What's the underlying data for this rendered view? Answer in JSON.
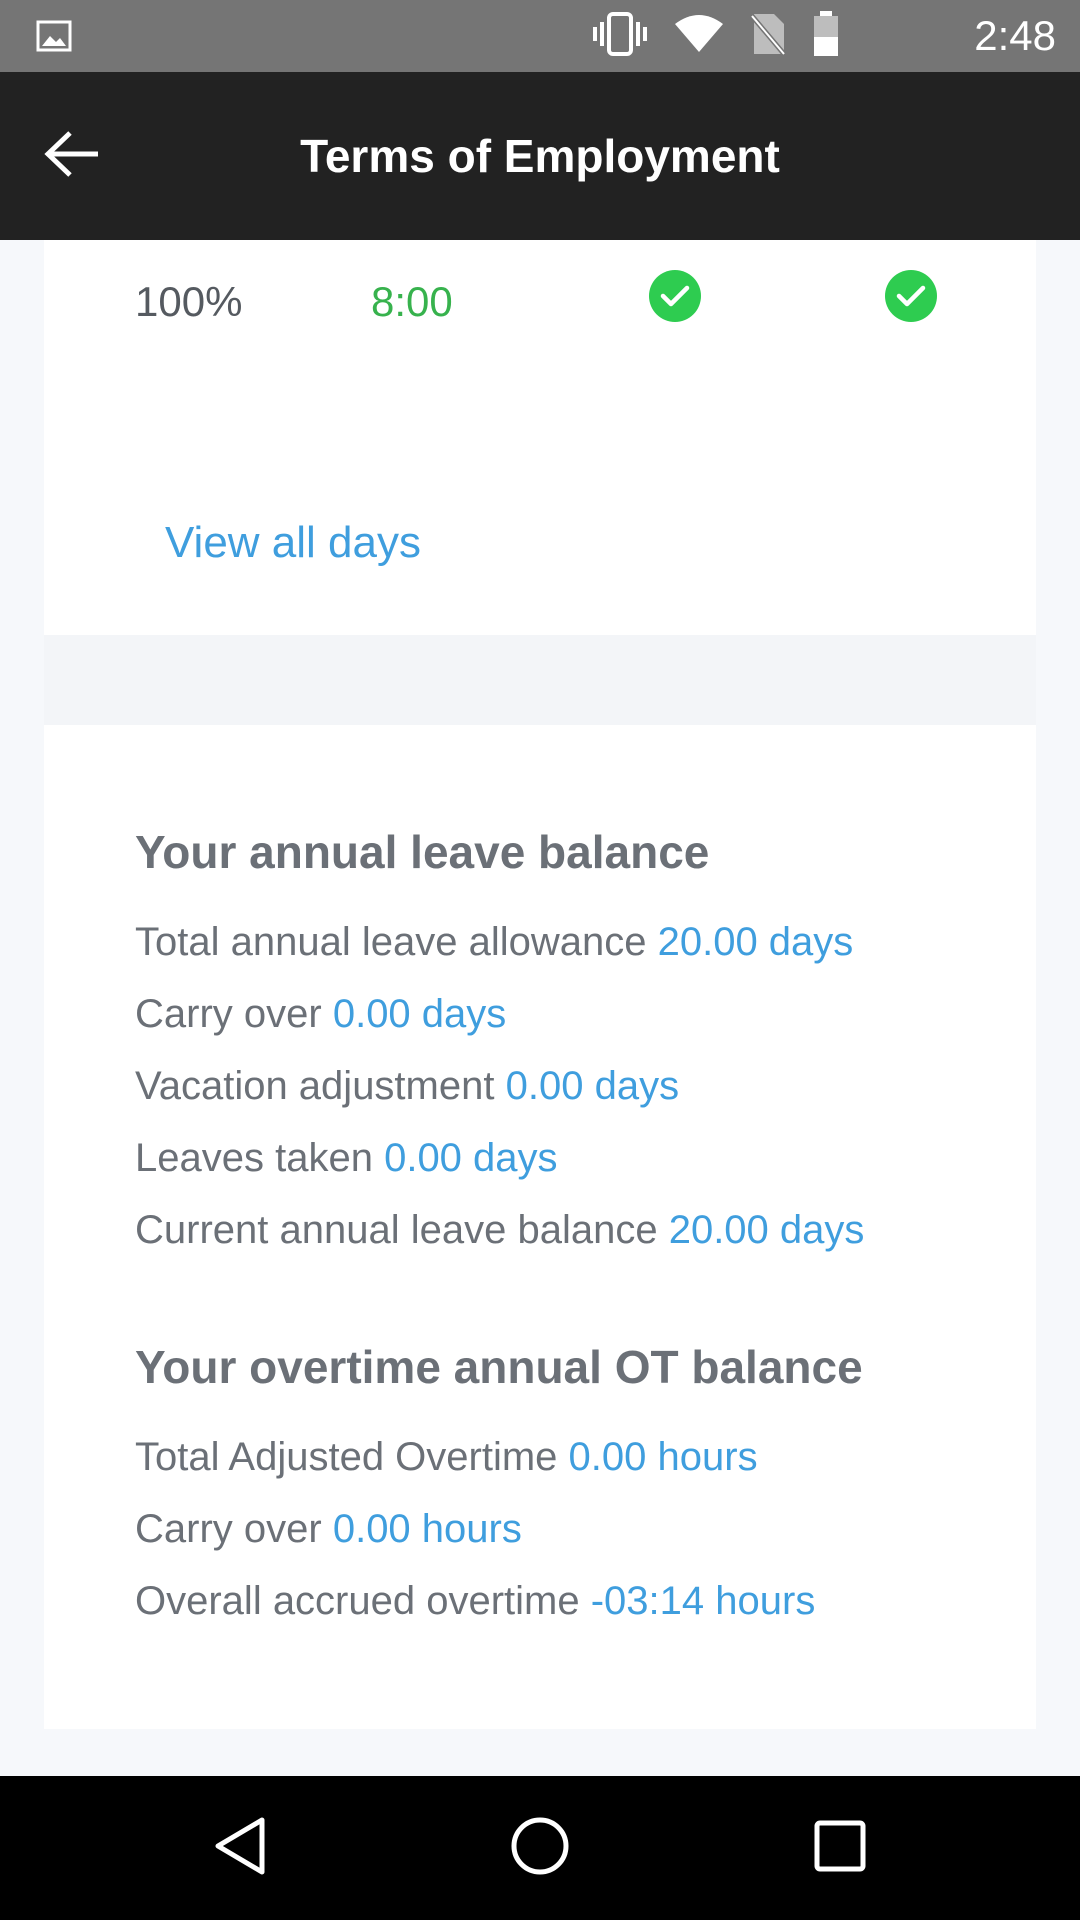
{
  "status_bar": {
    "time": "2:48",
    "icons": [
      "gallery-icon",
      "vibrate-icon",
      "wifi-icon",
      "no-sim-icon",
      "battery-icon"
    ]
  },
  "app_bar": {
    "title": "Terms of Employment",
    "back_icon": "arrow-left-icon"
  },
  "schedule_row": {
    "percentage": "100%",
    "hours": "8:00",
    "checks": [
      "check-circle-icon",
      "check-circle-icon"
    ]
  },
  "view_all_days": "View all days",
  "annual_leave": {
    "heading": "Your annual leave balance",
    "rows": [
      {
        "label": "Total annual leave allowance",
        "value": "20.00 days"
      },
      {
        "label": "Carry over",
        "value": "0.00 days"
      },
      {
        "label": "Vacation adjustment",
        "value": "0.00 days"
      },
      {
        "label": "Leaves taken",
        "value": "0.00 days"
      },
      {
        "label": "Current annual leave balance",
        "value": "20.00 days"
      }
    ]
  },
  "overtime": {
    "heading": "Your overtime annual OT balance",
    "rows": [
      {
        "label": "Total Adjusted Overtime",
        "value": "0.00 hours"
      },
      {
        "label": "Carry over",
        "value": "0.00 hours"
      },
      {
        "label": "Overall accrued overtime",
        "value": "-03:14 hours"
      }
    ]
  },
  "colors": {
    "status_bar": "#757575",
    "app_bar": "#222222",
    "accent_blue": "#3f9ede",
    "green_text": "#37b24d",
    "check_green": "#2ecc50",
    "label_gray": "#6b7077",
    "page_bg": "#f6f8fb"
  },
  "nav_bar": {
    "icons": [
      "nav-back-icon",
      "nav-home-icon",
      "nav-recents-icon"
    ]
  }
}
